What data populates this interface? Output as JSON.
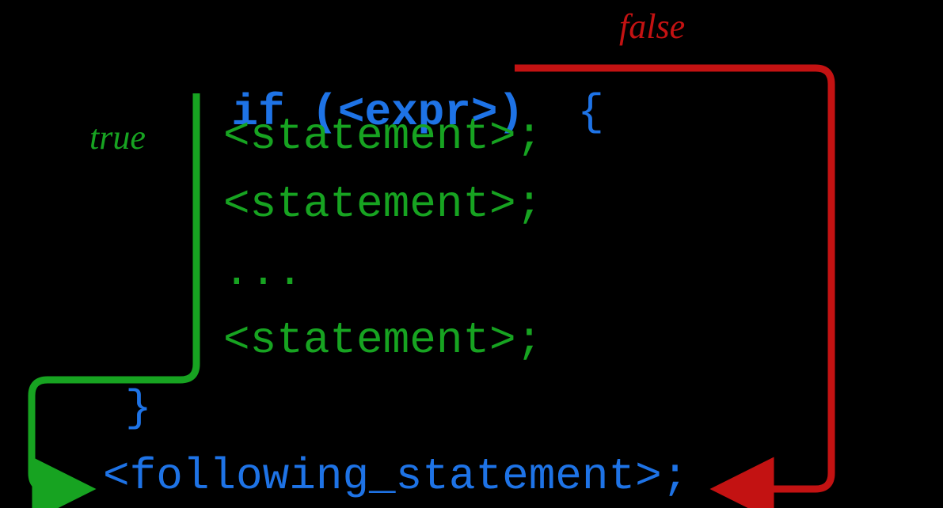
{
  "labels": {
    "true": "true",
    "false": "false"
  },
  "code": {
    "if_kw": "if",
    "open_paren": "(",
    "expr": "<expr>",
    "close_paren": ")",
    "open_brace": "{",
    "statements": [
      "<statement>;",
      "<statement>;",
      "...",
      "<statement>;"
    ],
    "close_brace": "}",
    "following": "<following_statement>;"
  },
  "colors": {
    "keyword": "#1e73e6",
    "statement": "#17a321",
    "true_arrow": "#17a321",
    "false_arrow": "#c31212",
    "background": "#000000"
  }
}
